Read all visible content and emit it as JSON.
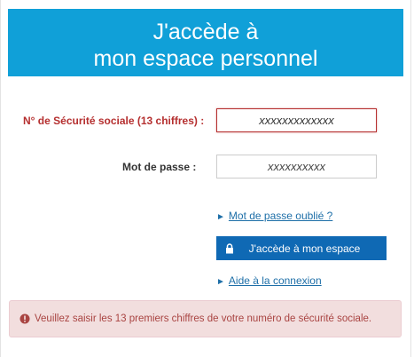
{
  "header": {
    "line1": "J'accède à",
    "line2": "mon espace personnel"
  },
  "form": {
    "ssn_label": "N° de Sécurité sociale (13 chiffres) :",
    "ssn_value": "xxxxxxxxxxxxx",
    "password_label": "Mot de passe :",
    "password_value": "xxxxxxxxxx"
  },
  "links": {
    "forgot_password": "Mot de passe oublié ?",
    "help": "Aide à la connexion",
    "arrow_glyph": "►"
  },
  "submit_button": {
    "label": "J'accède à mon espace",
    "icon": "lock-icon"
  },
  "alert": {
    "message": "Veuillez saisir les 13 premiers chiffres de votre numéro de sécurité sociale.",
    "icon": "exclamation-circle-icon"
  },
  "colors": {
    "header_bg": "#10a0d8",
    "button_bg": "#0f69b4",
    "error_text": "#b52f2f",
    "alert_bg": "#f2dede",
    "link": "#1e6fa8"
  }
}
